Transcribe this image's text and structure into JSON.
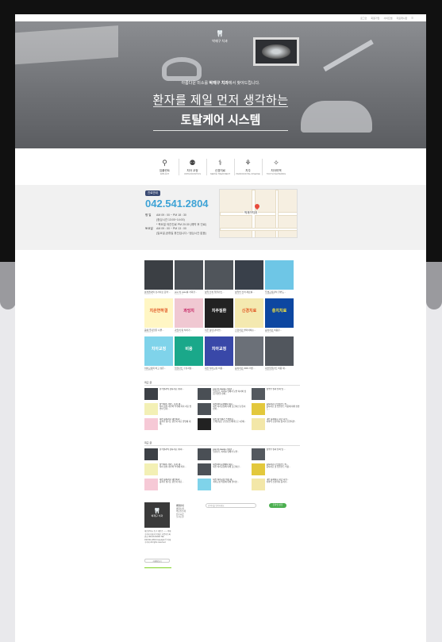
{
  "util_links": [
    "로그인",
    "회원가입",
    "사이트맵",
    "자료게시판",
    "☰"
  ],
  "logo": {
    "tooth": "🦷",
    "name": "박재구 치과"
  },
  "hero": {
    "sub_pre": "아름다운 미소를 ",
    "sub_bold": "박재구 치과",
    "sub_post": "에서 찾아드립니다.",
    "title1": "환자를 제일 먼저 생각하는",
    "title2": "토탈케어 시스템"
  },
  "services": [
    {
      "icon": "implant-icon",
      "glyph": "⚲",
      "ko": "임플란트",
      "en": "IMPLANT"
    },
    {
      "icon": "braces-icon",
      "glyph": "⚉",
      "ko": "치아 교정",
      "en": "ORTHODONTICS"
    },
    {
      "icon": "nerve-icon",
      "glyph": "⚕",
      "ko": "신경치료",
      "en": "NERVE TREATMENT"
    },
    {
      "icon": "gum-icon",
      "glyph": "⚘",
      "ko": "치주",
      "en": "PERIODONTAL DISEASE"
    },
    {
      "icon": "whitening-icon",
      "glyph": "✧",
      "ko": "치아미백",
      "en": "TOOTH WHITENING"
    }
  ],
  "info": {
    "badge": "진료안내",
    "phone": "042.541.2804",
    "hours": [
      {
        "label": "평  일",
        "value": "AM 09 : 00 ~ PM 18 : 30"
      },
      {
        "label": "",
        "value": "(점심시간 13:00~14:00)"
      },
      {
        "label": "",
        "value": "* 목요일 야간진료 PM 20:30 (예약 후 진료)"
      },
      {
        "label": "토요일",
        "value": "AM 09 : 00 ~ PM 13 : 00"
      },
      {
        "label": "",
        "value": "(일요일,공휴일 휴진입니다 / 점심시간 없음)"
      }
    ],
    "map_label": "박재구치과"
  },
  "grid": [
    [
      {
        "bg": "#3b3f44",
        "fg": "#fff",
        "text": "",
        "cap": "분석결과의 검사자료 요약 ...",
        "date": "2019.01.12"
      },
      {
        "bg": "#4b5056",
        "fg": "#fff",
        "text": "",
        "cap": "pret 치 case를 저희한...",
        "date": "2019.01.12"
      },
      {
        "bg": "#50555b",
        "fg": "#fff",
        "text": "",
        "cap": "상악 전치 임플란트...",
        "date": "2019.01.12"
      },
      {
        "bg": "#39404a",
        "fg": "#fff",
        "text": "",
        "cap": "상악부 전치 재료를...",
        "date": "2019.01.12"
      },
      {
        "bg": "#6ec6e6",
        "fg": "#fff",
        "text": "",
        "cap": "투명교정장치 한번도...",
        "date": "2019.01.12"
      }
    ],
    [
      {
        "bg": "#fff6c4",
        "fg": "#e0531f",
        "text": "치은연하결",
        "cap": "몸에 좋지않은 나쁜...",
        "date": "2019.01.12"
      },
      {
        "bg": "#f0c8d2",
        "fg": "#c2185b",
        "text": "과잉치",
        "cap": "과잉치 외 치아가...",
        "date": "2019.01.12"
      },
      {
        "bg": "#222",
        "fg": "#fff",
        "text": "치주질환",
        "cap": "치주 상태 관리법...",
        "date": "2019.01.12"
      },
      {
        "bg": "#f4e9b0",
        "fg": "#e0531f",
        "text": "신경치료",
        "cap": "신경치료 받아야하는...",
        "date": "2019.01.12"
      },
      {
        "bg": "#0d47a1",
        "fg": "#ffeb3b",
        "text": "충치치료",
        "cap": "충치치료 비용은...",
        "date": "2019.01.12"
      }
    ],
    [
      {
        "bg": "#7fd3ea",
        "fg": "#fff",
        "text": "치아교정",
        "cap": "치아교정의 하고 싶은...",
        "date": "2019.01.12"
      },
      {
        "bg": "#1aa88a",
        "fg": "#fff",
        "text": "비용",
        "cap": "임플란트 수술과정...",
        "date": "2019.01.12"
      },
      {
        "bg": "#3948a8",
        "fg": "#fff",
        "text": "치아교정",
        "cap": "대전 치아교정 비용...",
        "date": "2019.01.12"
      },
      {
        "bg": "#6b7078",
        "fg": "#fff",
        "text": "",
        "cap": "충치치료 ORN 어떤...",
        "date": "2019.01.12"
      },
      {
        "bg": "#51565d",
        "fg": "#fff",
        "text": "",
        "cap": "대전임플란트 비용 재...",
        "date": "2019.01.12"
      }
    ]
  ],
  "list1": {
    "title": "최근 글",
    "items": [
      {
        "bg": "#3c4046",
        "title": "분석결과의 검사자료 (리라...",
        "body": ""
      },
      {
        "bg": "#4a4f55",
        "title": "pret 치 case를 저희한 ...",
        "body": "임플란트 치아를 옆에서 보면 치아와 잇몸 라인을 살펴..."
      },
      {
        "bg": "#54595f",
        "title": "상악부 결과 전치 임 ...",
        "body": ""
      },
      {
        "bg": "#f3f0b5",
        "title": "상악치아 가이드 순서 재...",
        "body": "치아 상실 개수와 부위에 따라 치료 방법이 달라..."
      },
      {
        "bg": "#4c5157",
        "title": "대전치아교정에서 재료...",
        "body": "대전 치아교정에 대해 궁금하신 분들이 많아..."
      },
      {
        "bg": "#e3c83c",
        "title": "충치치료나 임플란트 비...",
        "body": "충치치료 및 임플란트 비용에 대해 설명드..."
      },
      {
        "bg": "#f6c9d6",
        "title": "대전 충치치료 대전치과...",
        "body": "충치가 생기는 원인과 치료 방법에 대해..."
      },
      {
        "bg": "#222",
        "title": "대전 치석제거 스케일링...",
        "body": "스케일링은 건강보험 혜택으로 1년에..."
      },
      {
        "bg": "#f3e7a8",
        "title": "대전 충치치료 지금 시작...",
        "body": "치아의 신경까지 충치가 진행되면..."
      }
    ]
  },
  "list2": {
    "title": "최근 글",
    "items": [
      {
        "bg": "#3c4046",
        "title": "분석결과의 검사자료 (리라...",
        "body": ""
      },
      {
        "bg": "#4a4f55",
        "title": "pret 치 case를 저희한 ...",
        "body": "임플란트 치아를 옆에서 보면..."
      },
      {
        "bg": "#54595f",
        "title": "상악부 결과 전치 임 ...",
        "body": ""
      },
      {
        "bg": "#f3f0b5",
        "title": "상악치아 가이드 순서 재...",
        "body": "치아 상실 개수와 부위에 따라..."
      },
      {
        "bg": "#4c5157",
        "title": "대전치아교정에서 재료...",
        "body": "대전 치아교정에 대해 궁금하신..."
      },
      {
        "bg": "#e3c83c",
        "title": "충치치료나 임플란트 비...",
        "body": "충치치료 및 임플란트 비용..."
      },
      {
        "bg": "#f6c9d6",
        "title": "대전 충치치료 대전치과...",
        "body": "충치가 생기는 원인과 치료..."
      },
      {
        "bg": "#7fd3ea",
        "title": "대전 치아교정 비용 재...",
        "body": "치아교정 비용에 대해 알아보..."
      },
      {
        "bg": "#f3e7a8",
        "title": "대전 충치치료 지금 시작...",
        "body": "치아의 신경까지 충치가..."
      }
    ]
  },
  "footer": {
    "logo_tooth": "🦷",
    "logo_name": "박재구 치과",
    "menu_title": "병원안내",
    "menu": [
      "병원소개",
      "의료진소개",
      "진료시간",
      "오시는길"
    ],
    "address": "대전광역시 동구 대전로 ○○○ 박재구치과 대표자 박재구 사업자등록번호 000-00-00000 TEL 042.541.2804 Copyright © 박재구치과 All rights reserved.",
    "search_placeholder": "검색어를 입력하세요",
    "phone_small": "042.541.2804",
    "green_btn": "온라인 상담",
    "more_btn": "자세히보기"
  }
}
